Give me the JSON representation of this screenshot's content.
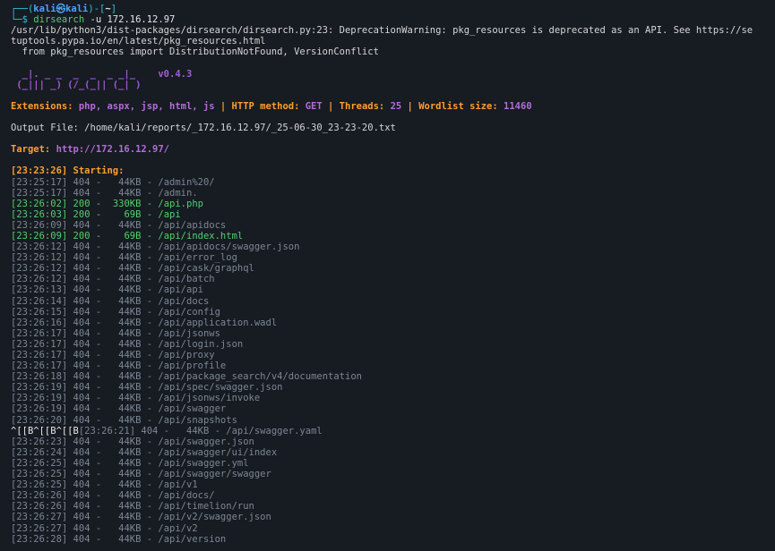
{
  "prompt": {
    "line1_prefix": "┌──(",
    "user": "kali",
    "at": "㉿",
    "host": "kali",
    "dir_open": ")-[",
    "dir": "~",
    "dir_close": "]",
    "line2_prefix": "└─$ ",
    "command": "dirsearch",
    "args": " -u 172.16.12.97"
  },
  "warning": [
    "/usr/lib/python3/dist-packages/dirsearch/dirsearch.py:23: DeprecationWarning: pkg_resources is deprecated as an API. See https://se",
    "tuptools.pypa.io/en/latest/pkg_resources.html",
    "  from pkg_resources import DistributionNotFound, VersionConflict"
  ],
  "banner": {
    "art_line1": "  _|. _ _  _  _  _ _|_    v0.4.3",
    "art_line2": " (_||| _) (/_(_|| (_| )"
  },
  "config": {
    "ext_label": "Extensions: ",
    "ext_value": "php, aspx, jsp, html, js",
    "sep": " | ",
    "method_label": "HTTP method: ",
    "method_value": "GET",
    "threads_label": "Threads: ",
    "threads_value": "25",
    "wordlist_label": "Wordlist size: ",
    "wordlist_value": "11460"
  },
  "output_file": "Output File: /home/kali/reports/_172.16.12.97/_25-06-30_23-23-20.txt",
  "target": {
    "label": "Target: ",
    "url": "http://172.16.12.97/"
  },
  "starting": "[23:23:26] Starting:",
  "results": [
    {
      "time": "[23:25:17]",
      "status": "404",
      "size": "44KB",
      "path": "/admin%20/",
      "ok": false
    },
    {
      "time": "[23:25:17]",
      "status": "404",
      "size": "44KB",
      "path": "/admin.",
      "ok": false
    },
    {
      "time": "[23:26:02]",
      "status": "200",
      "size": "330KB",
      "path": "/api.php",
      "ok": true
    },
    {
      "time": "[23:26:03]",
      "status": "200",
      "size": "69B",
      "path": "/api",
      "ok": true
    },
    {
      "time": "[23:26:09]",
      "status": "404",
      "size": "44KB",
      "path": "/api/apidocs",
      "ok": false
    },
    {
      "time": "[23:26:09]",
      "status": "200",
      "size": "69B",
      "path": "/api/index.html",
      "ok": true
    },
    {
      "time": "[23:26:12]",
      "status": "404",
      "size": "44KB",
      "path": "/api/apidocs/swagger.json",
      "ok": false
    },
    {
      "time": "[23:26:12]",
      "status": "404",
      "size": "44KB",
      "path": "/api/error_log",
      "ok": false
    },
    {
      "time": "[23:26:12]",
      "status": "404",
      "size": "44KB",
      "path": "/api/cask/graphql",
      "ok": false
    },
    {
      "time": "[23:26:12]",
      "status": "404",
      "size": "44KB",
      "path": "/api/batch",
      "ok": false
    },
    {
      "time": "[23:26:13]",
      "status": "404",
      "size": "44KB",
      "path": "/api/api",
      "ok": false
    },
    {
      "time": "[23:26:14]",
      "status": "404",
      "size": "44KB",
      "path": "/api/docs",
      "ok": false
    },
    {
      "time": "[23:26:15]",
      "status": "404",
      "size": "44KB",
      "path": "/api/config",
      "ok": false
    },
    {
      "time": "[23:26:16]",
      "status": "404",
      "size": "44KB",
      "path": "/api/application.wadl",
      "ok": false
    },
    {
      "time": "[23:26:17]",
      "status": "404",
      "size": "44KB",
      "path": "/api/jsonws",
      "ok": false
    },
    {
      "time": "[23:26:17]",
      "status": "404",
      "size": "44KB",
      "path": "/api/login.json",
      "ok": false
    },
    {
      "time": "[23:26:17]",
      "status": "404",
      "size": "44KB",
      "path": "/api/proxy",
      "ok": false
    },
    {
      "time": "[23:26:17]",
      "status": "404",
      "size": "44KB",
      "path": "/api/profile",
      "ok": false
    },
    {
      "time": "[23:26:18]",
      "status": "404",
      "size": "44KB",
      "path": "/api/package_search/v4/documentation",
      "ok": false
    },
    {
      "time": "[23:26:19]",
      "status": "404",
      "size": "44KB",
      "path": "/api/spec/swagger.json",
      "ok": false
    },
    {
      "time": "[23:26:19]",
      "status": "404",
      "size": "44KB",
      "path": "/api/jsonws/invoke",
      "ok": false
    },
    {
      "time": "[23:26:19]",
      "status": "404",
      "size": "44KB",
      "path": "/api/swagger",
      "ok": false
    },
    {
      "time": "[23:26:20]",
      "status": "404",
      "size": "44KB",
      "path": "/api/snapshots",
      "ok": false
    },
    {
      "time": "[23:26:21]",
      "status": "404",
      "size": "44KB",
      "path": "/api/swagger.yaml",
      "ok": false,
      "prefix": "^[[B^[[B^[[B"
    },
    {
      "time": "[23:26:23]",
      "status": "404",
      "size": "44KB",
      "path": "/api/swagger.json",
      "ok": false
    },
    {
      "time": "[23:26:24]",
      "status": "404",
      "size": "44KB",
      "path": "/api/swagger/ui/index",
      "ok": false
    },
    {
      "time": "[23:26:25]",
      "status": "404",
      "size": "44KB",
      "path": "/api/swagger.yml",
      "ok": false
    },
    {
      "time": "[23:26:25]",
      "status": "404",
      "size": "44KB",
      "path": "/api/swagger/swagger",
      "ok": false
    },
    {
      "time": "[23:26:25]",
      "status": "404",
      "size": "44KB",
      "path": "/api/v1",
      "ok": false
    },
    {
      "time": "[23:26:26]",
      "status": "404",
      "size": "44KB",
      "path": "/api/docs/",
      "ok": false
    },
    {
      "time": "[23:26:26]",
      "status": "404",
      "size": "44KB",
      "path": "/api/timelion/run",
      "ok": false
    },
    {
      "time": "[23:26:27]",
      "status": "404",
      "size": "44KB",
      "path": "/api/v2/swagger.json",
      "ok": false
    },
    {
      "time": "[23:26:27]",
      "status": "404",
      "size": "44KB",
      "path": "/api/v2",
      "ok": false
    },
    {
      "time": "[23:26:28]",
      "status": "404",
      "size": "44KB",
      "path": "/api/version",
      "ok": false
    }
  ],
  "colors": {
    "background": "#171b22",
    "prompt_frame": "#36c0d6",
    "user_host": "#4ea3ff",
    "config_label": "#ff9e2c",
    "config_value": "#b46cd9",
    "ok_status": "#4fd16d",
    "not_found": "#7d8794"
  }
}
